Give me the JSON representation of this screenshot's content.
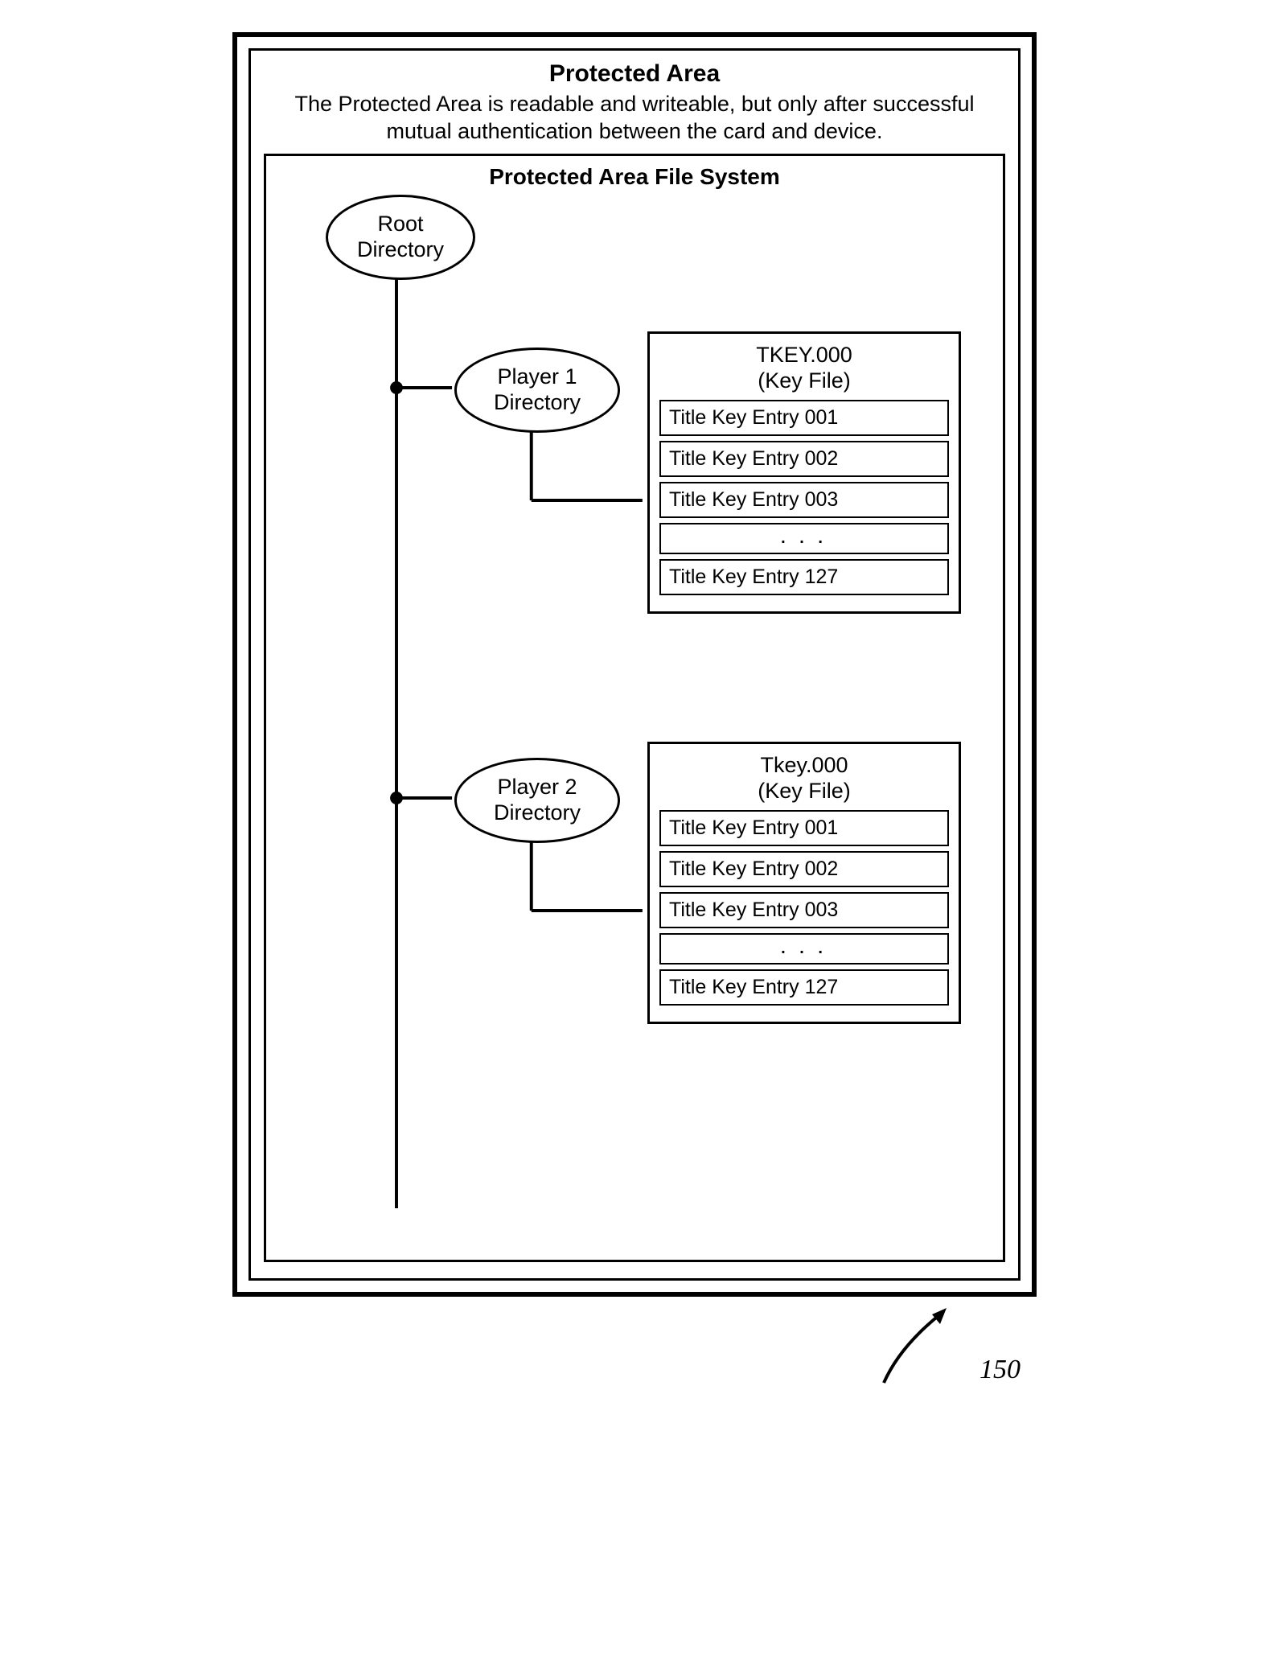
{
  "protected_area": {
    "title": "Protected Area",
    "description": "The Protected Area is readable and writeable, but only after successful mutual authentication between the card and device."
  },
  "filesystem": {
    "title": "Protected Area File System",
    "root_label": "Root\nDirectory",
    "players": [
      {
        "dir_label": "Player 1\nDirectory",
        "keyfile": {
          "name": "TKEY.000",
          "subtitle": "(Key File)",
          "entries": [
            "Title Key Entry 001",
            "Title Key Entry 002",
            "Title Key Entry 003",
            ". . .",
            "Title Key Entry 127"
          ]
        }
      },
      {
        "dir_label": "Player 2\nDirectory",
        "keyfile": {
          "name": "Tkey.000",
          "subtitle": "(Key File)",
          "entries": [
            "Title Key Entry 001",
            "Title Key Entry 002",
            "Title Key Entry 003",
            ". . .",
            "Title Key Entry 127"
          ]
        }
      }
    ]
  },
  "reference_number": "150"
}
